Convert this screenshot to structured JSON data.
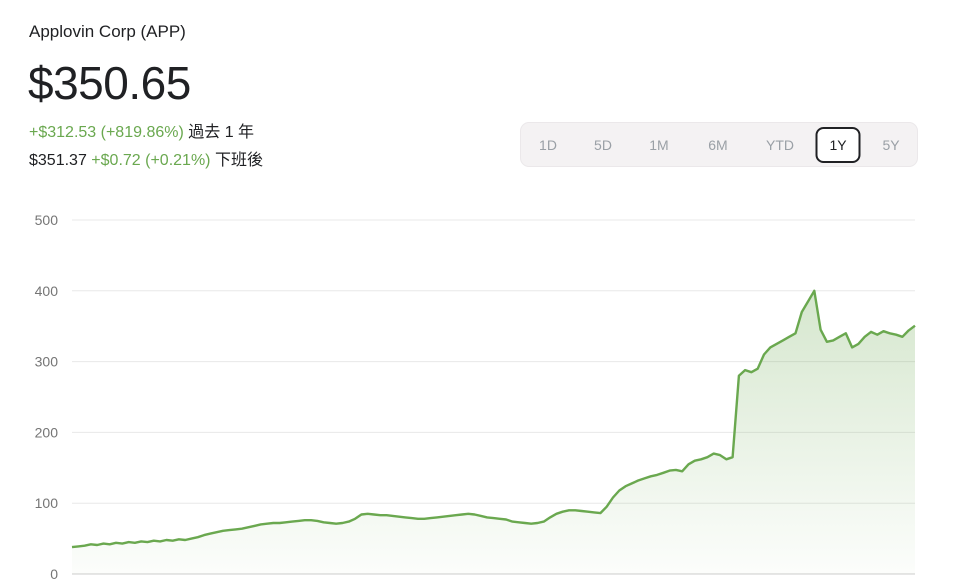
{
  "header": {
    "title": "Applovin Corp (APP)",
    "price": "$350.65",
    "change": "+$312.53 (+819.86%)",
    "period": "過去 1 年",
    "after_price": "$351.37",
    "after_change": "+$0.72 (+0.21%)",
    "after_label": "下班後"
  },
  "ranges": [
    "1D",
    "5D",
    "1M",
    "6M",
    "YTD",
    "1Y",
    "5Y"
  ],
  "selected_range": "1Y",
  "colors": {
    "line": "#6aa84f",
    "fill": "#6aa84f",
    "grid": "#e8e8e8"
  },
  "chart_data": {
    "type": "area",
    "title": "",
    "xlabel": "",
    "ylabel": "",
    "ylim": [
      0,
      500
    ],
    "yticks": [
      "0",
      "100",
      "200",
      "300",
      "400",
      "500"
    ],
    "grid": true,
    "series": [
      {
        "values": [
          38,
          39,
          40,
          42,
          41,
          43,
          42,
          44,
          43,
          45,
          44,
          46,
          45,
          47,
          46,
          48,
          47,
          49,
          48,
          50,
          52,
          55,
          57,
          59,
          61,
          62,
          63,
          64,
          66,
          68,
          70,
          71,
          72,
          72,
          73,
          74,
          75,
          76,
          76,
          75,
          73,
          72,
          71,
          72,
          74,
          78,
          84,
          85,
          84,
          83,
          83,
          82,
          81,
          80,
          79,
          78,
          78,
          79,
          80,
          81,
          82,
          83,
          84,
          85,
          84,
          82,
          80,
          79,
          78,
          77,
          74,
          73,
          72,
          71,
          72,
          74,
          80,
          85,
          88,
          90,
          90,
          89,
          88,
          87,
          86,
          95,
          108,
          118,
          124,
          128,
          132,
          135,
          138,
          140,
          143,
          146,
          147,
          145,
          155,
          160,
          162,
          165,
          170,
          168,
          162,
          165,
          280,
          288,
          285,
          290,
          310,
          320,
          325,
          330,
          335,
          340,
          370,
          385,
          400,
          345,
          328,
          330,
          335,
          340,
          320,
          325,
          335,
          342,
          338,
          343,
          340,
          338,
          335,
          344,
          350.65
        ]
      }
    ]
  }
}
